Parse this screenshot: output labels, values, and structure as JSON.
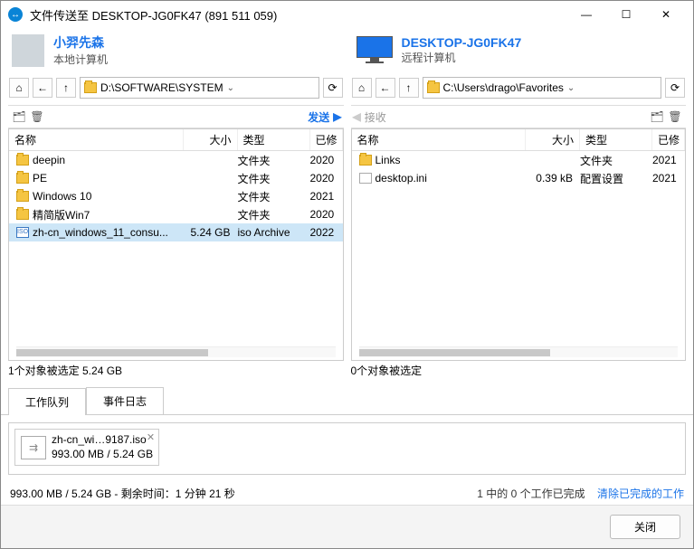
{
  "window": {
    "title": "文件传送至 DESKTOP-JG0FK47 (891 511 059)"
  },
  "local": {
    "name": "小羿先森",
    "subtitle": "本地计算机",
    "path": "D:\\SOFTWARE\\SYSTEM",
    "status": "1个对象被选定  5.24 GB"
  },
  "remote": {
    "name": "DESKTOP-JG0FK47",
    "subtitle": "远程计算机",
    "path": "C:\\Users\\drago\\Favorites",
    "status": "0个对象被选定"
  },
  "actions": {
    "send": "发送",
    "receive": "接收"
  },
  "columns": {
    "name": "名称",
    "size": "大小",
    "type": "类型",
    "modified": "已修"
  },
  "local_files": [
    {
      "name": "deepin",
      "size": "",
      "type": "文件夹",
      "mod": "2020",
      "icon": "folder"
    },
    {
      "name": "PE",
      "size": "",
      "type": "文件夹",
      "mod": "2020",
      "icon": "folder"
    },
    {
      "name": "Windows 10",
      "size": "",
      "type": "文件夹",
      "mod": "2021",
      "icon": "folder"
    },
    {
      "name": "精简版Win7",
      "size": "",
      "type": "文件夹",
      "mod": "2020",
      "icon": "folder"
    },
    {
      "name": "zh-cn_windows_11_consu...",
      "size": "5.24 GB",
      "type": "iso Archive",
      "mod": "2022",
      "icon": "iso",
      "selected": true
    }
  ],
  "remote_files": [
    {
      "name": "Links",
      "size": "",
      "type": "文件夹",
      "mod": "2021",
      "icon": "folder"
    },
    {
      "name": "desktop.ini",
      "size": "0.39 kB",
      "type": "配置设置",
      "mod": "2021",
      "icon": "ini"
    }
  ],
  "tabs": {
    "queue": "工作队列",
    "log": "事件日志"
  },
  "queue_item": {
    "name": "zh-cn_wi…9187.iso",
    "progress": "993.00 MB / 5.24 GB"
  },
  "bottom": {
    "left": "993.00 MB / 5.24 GB - 剩余时间：1 分钟 21 秒",
    "right": "1 中的 0 个工作已完成",
    "link": "清除已完成的工作"
  },
  "footer": {
    "close": "关闭"
  }
}
